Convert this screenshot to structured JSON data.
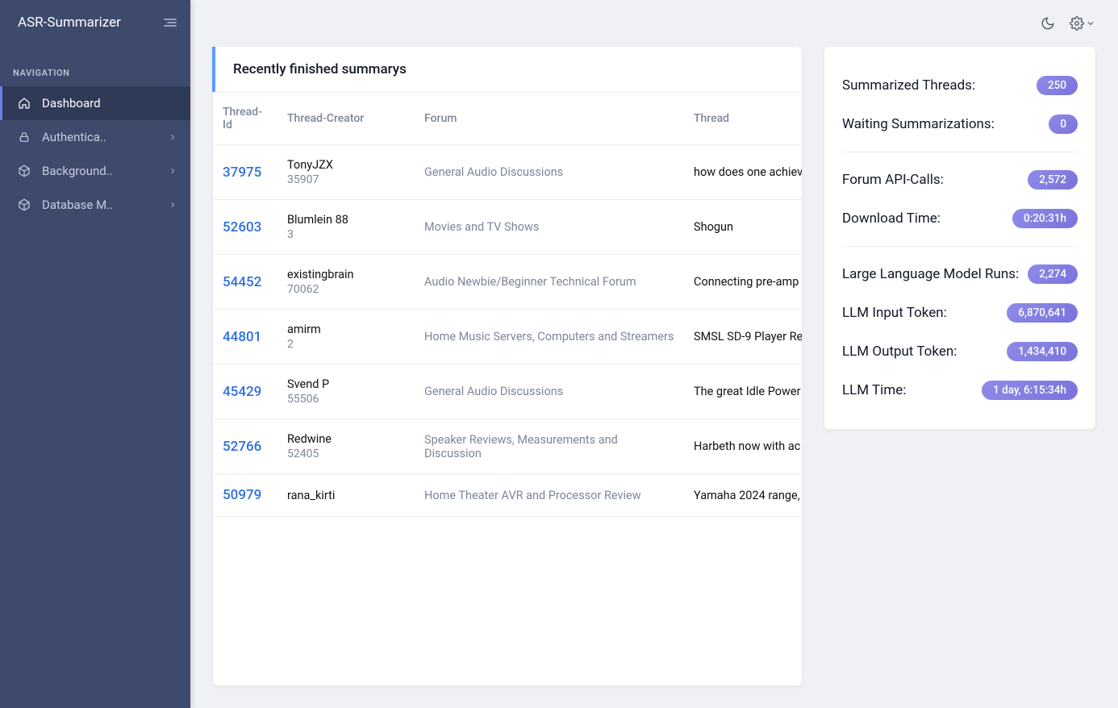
{
  "app": {
    "title": "ASR-Summarizer"
  },
  "nav": {
    "section_label": "NAVIGATION",
    "items": [
      {
        "label": "Dashboard",
        "icon": "home",
        "active": true,
        "expandable": false
      },
      {
        "label": "Authentica..",
        "icon": "lock",
        "active": false,
        "expandable": true
      },
      {
        "label": "Background..",
        "icon": "cube",
        "active": false,
        "expandable": true
      },
      {
        "label": "Database M..",
        "icon": "cube",
        "active": false,
        "expandable": true
      }
    ]
  },
  "main_card": {
    "title": "Recently finished summarys",
    "columns": [
      "Thread-Id",
      "Thread-Creator",
      "Forum",
      "Thread"
    ],
    "rows": [
      {
        "id": "37975",
        "creator": "TonyJZX",
        "creator_sub": "35907",
        "forum": "General Audio Discussions",
        "thread": "how does one achiev"
      },
      {
        "id": "52603",
        "creator": "Blumlein 88",
        "creator_sub": "3",
        "forum": "Movies and TV Shows",
        "thread": "Shogun"
      },
      {
        "id": "54452",
        "creator": "existingbrain",
        "creator_sub": "70062",
        "forum": "Audio Newbie/Beginner Technical Forum",
        "thread": "Connecting pre-amp"
      },
      {
        "id": "44801",
        "creator": "amirm",
        "creator_sub": "2",
        "forum": "Home Music Servers, Computers and Streamers",
        "thread": "SMSL SD-9 Player Re"
      },
      {
        "id": "45429",
        "creator": "Svend P",
        "creator_sub": "55506",
        "forum": "General Audio Discussions",
        "thread": "The great Idle Power"
      },
      {
        "id": "52766",
        "creator": "Redwine",
        "creator_sub": "52405",
        "forum": "Speaker Reviews, Measurements and Discussion",
        "thread": "Harbeth now with ac"
      },
      {
        "id": "50979",
        "creator": "rana_kirti",
        "creator_sub": "",
        "forum": "Home Theater AVR and Processor Review",
        "thread": "Yamaha 2024 range,"
      }
    ]
  },
  "stats": {
    "group1": [
      {
        "label": "Summarized Threads:",
        "value": "250"
      },
      {
        "label": "Waiting Summarizations:",
        "value": "0"
      }
    ],
    "group2": [
      {
        "label": "Forum API-Calls:",
        "value": "2,572"
      },
      {
        "label": "Download Time:",
        "value": "0:20:31h"
      }
    ],
    "group3": [
      {
        "label": "Large Language Model Runs:",
        "value": "2,274"
      },
      {
        "label": "LLM Input Token:",
        "value": "6,870,641"
      },
      {
        "label": "LLM Output Token:",
        "value": "1,434,410"
      },
      {
        "label": "LLM Time:",
        "value": "1 day, 6:15:34h"
      }
    ]
  }
}
